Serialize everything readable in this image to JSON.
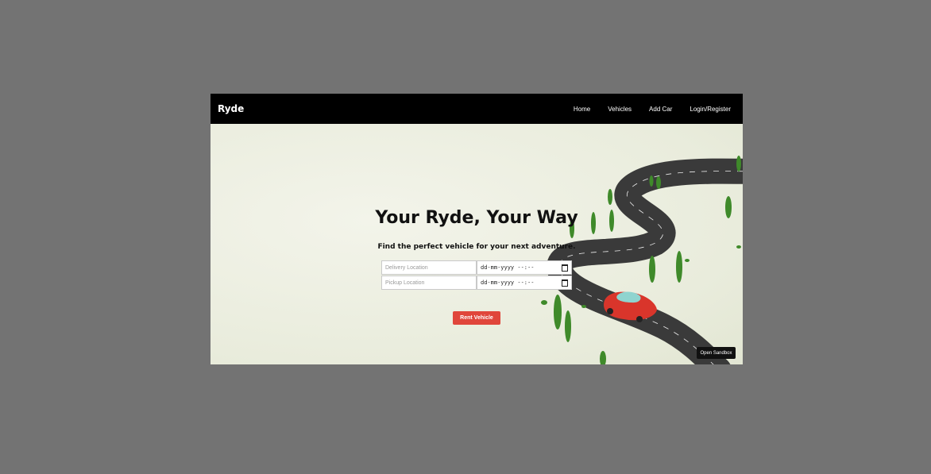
{
  "navbar": {
    "brand": "Ryde",
    "links": [
      "Home",
      "Vehicles",
      "Add Car",
      "Login/Register"
    ]
  },
  "hero": {
    "title": "Your Ryde, Your Way",
    "subtitle": "Find the perfect vehicle for your next adventure."
  },
  "form": {
    "delivery_placeholder": "Delivery Location",
    "pickup_placeholder": "Pickup Location",
    "delivery_date": "dd-mm-yyyy --:--",
    "pickup_date": "dd-mm-yyyy --:--",
    "rent_label": "Rent Vehicle"
  },
  "sandbox_label": "Open Sandbox",
  "colors": {
    "navbar_bg": "#000000",
    "accent": "#e0463b",
    "car": "#d9352b",
    "road": "#3a3a3a",
    "tree": "#3f8a2a"
  },
  "icons": {
    "date": "calendar-icon"
  }
}
